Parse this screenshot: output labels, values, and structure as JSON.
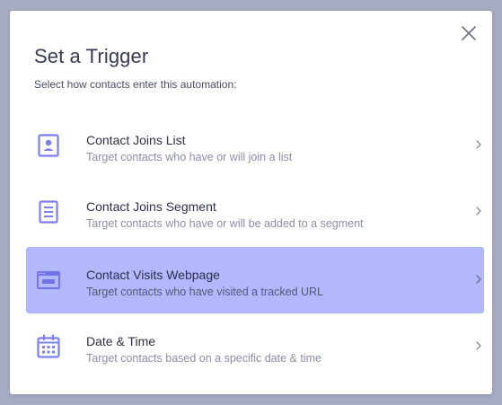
{
  "modal": {
    "title": "Set a Trigger",
    "subtitle": "Select how contacts enter this automation:",
    "close_icon": "close-icon"
  },
  "options": [
    {
      "title": "Contact Joins List",
      "description": "Target contacts who have or will join a list",
      "icon": "contact-card-icon",
      "selected": false
    },
    {
      "title": "Contact Joins Segment",
      "description": "Target contacts who have or will be added to a segment",
      "icon": "segment-document-icon",
      "selected": false
    },
    {
      "title": "Contact Visits Webpage",
      "description": "Target contacts who have visited a tracked URL",
      "icon": "browser-window-icon",
      "selected": true
    },
    {
      "title": "Date & Time",
      "description": "Target contacts based on a specific date & time",
      "icon": "calendar-icon",
      "selected": false
    }
  ],
  "colors": {
    "backdrop": "#a7abc2",
    "accent": "#7b7ff2",
    "selected_background": "#b3b7fb",
    "title_text": "#373b52",
    "muted_text": "#8a8ea6"
  }
}
